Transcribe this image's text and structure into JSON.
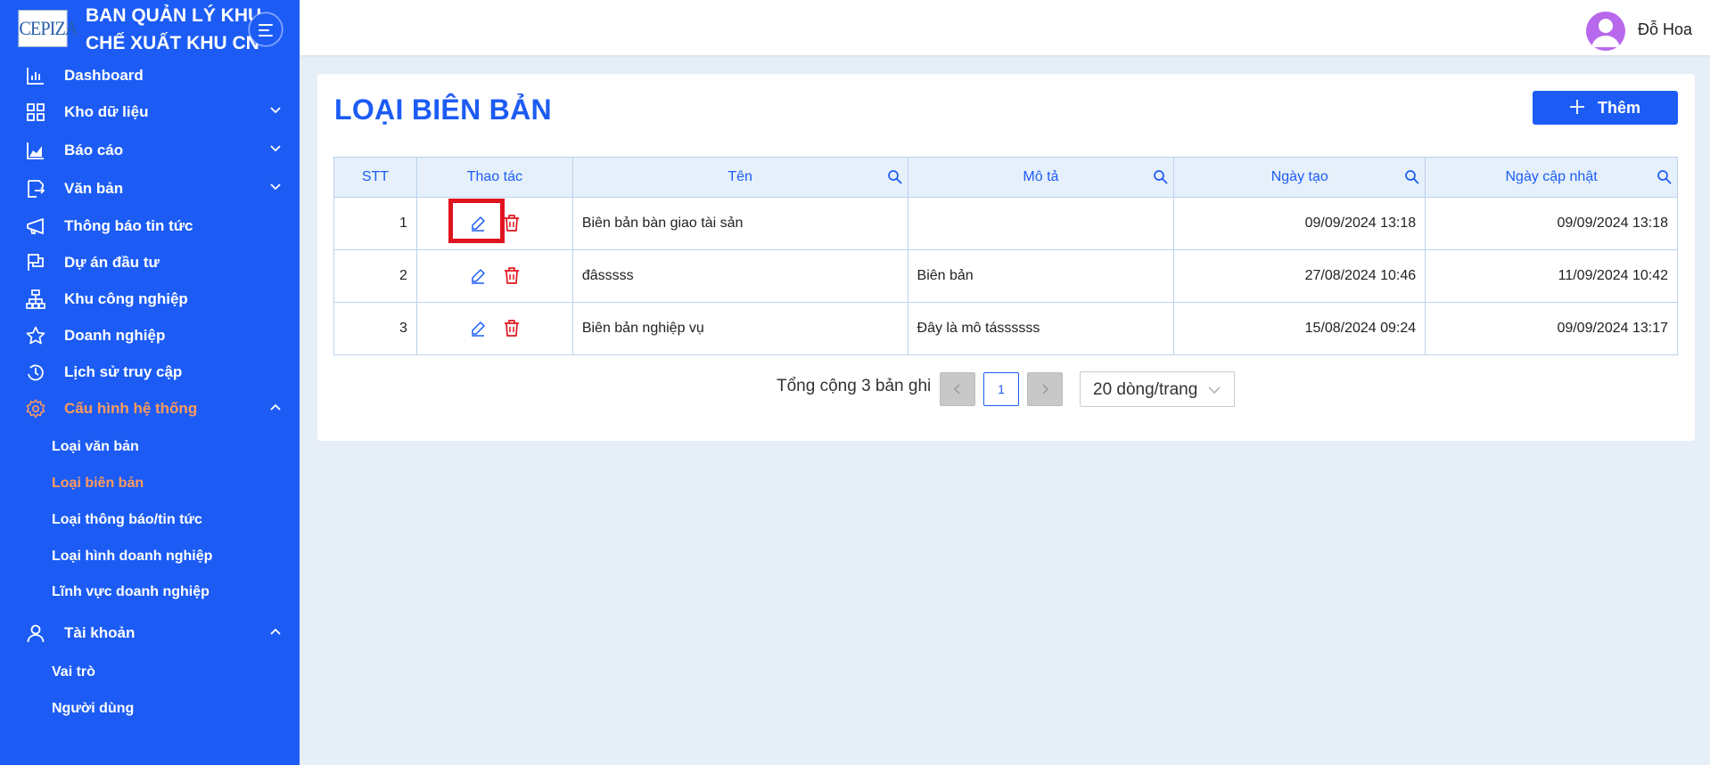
{
  "brand": {
    "logo_text": "CEPIZA",
    "title": "BAN QUẢN LÝ KHU\nCHẾ XUẤT KHU CN"
  },
  "sidebar": {
    "items": [
      {
        "label": "Dashboard",
        "icon": "bar-chart-icon"
      },
      {
        "label": "Kho dữ liệu",
        "icon": "grid-icon",
        "expandable": true,
        "expanded": false
      },
      {
        "label": "Báo cáo",
        "icon": "area-chart-icon",
        "expandable": true,
        "expanded": false
      },
      {
        "label": "Văn bản",
        "icon": "document-icon",
        "expandable": true,
        "expanded": false
      },
      {
        "label": "Thông báo tin tức",
        "icon": "megaphone-icon"
      },
      {
        "label": "Dự án đầu tư",
        "icon": "flag-icon"
      },
      {
        "label": "Khu công nghiệp",
        "icon": "org-chart-icon"
      },
      {
        "label": "Doanh nghiệp",
        "icon": "star-icon"
      },
      {
        "label": "Lịch sử truy cập",
        "icon": "clock-icon"
      },
      {
        "label": "Cấu hình hệ thống",
        "icon": "gear-icon",
        "expandable": true,
        "expanded": true,
        "active": true
      },
      {
        "label": "Tài khoản",
        "icon": "user-icon",
        "expandable": true,
        "expanded": true
      }
    ],
    "config_children": [
      "Loại văn bản",
      "Loại biên bản",
      "Loại thông báo/tin tức",
      "Loại hình doanh nghiệp",
      "Lĩnh vực doanh nghiệp"
    ],
    "account_children": [
      "Vai trò",
      "Người dùng"
    ],
    "active_child": "Loại biên bản"
  },
  "header": {
    "user_name": "Đỗ Hoa"
  },
  "page": {
    "title": "LOẠI BIÊN BẢN",
    "add_label": "Thêm"
  },
  "table": {
    "headers": [
      "STT",
      "Thao tác",
      "Tên",
      "Mô tả",
      "Ngày tạo",
      "Ngày cập nhật"
    ],
    "rows": [
      {
        "stt": "1",
        "name": "Biên bản bàn giao tài sản",
        "description": "",
        "created": "09/09/2024 13:18",
        "updated": "09/09/2024 13:18"
      },
      {
        "stt": "2",
        "name": "đâsssss",
        "description": "Biên bản",
        "created": "27/08/2024 10:46",
        "updated": "11/09/2024 10:42"
      },
      {
        "stt": "3",
        "name": "Biên bản nghiệp vụ",
        "description": "Đây là mô tássssss",
        "created": "15/08/2024 09:24",
        "updated": "09/09/2024 13:17"
      }
    ]
  },
  "pagination": {
    "total_text": "Tổng cộng 3 bản ghi",
    "current_page": "1",
    "page_size": "20 dòng/trang"
  },
  "colors": {
    "primary": "#1c5cf5",
    "active_menu": "#ff9a5c",
    "delete": "#e0141f",
    "highlight": "#e0141f"
  }
}
